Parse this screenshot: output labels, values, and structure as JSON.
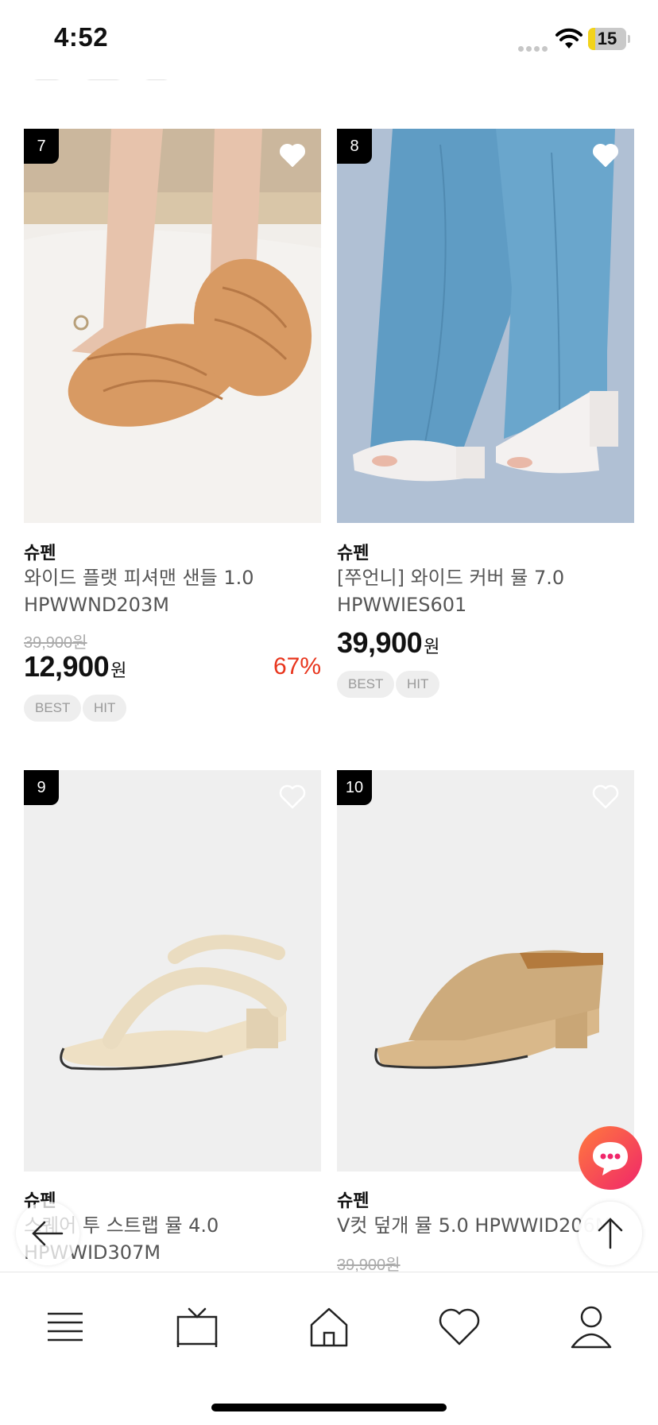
{
  "status_bar": {
    "time": "4:52",
    "battery": "15"
  },
  "products": [
    {
      "rank": "7",
      "brand": "슈펜",
      "name_line1": "와이드 플랫 피셔맨 샌들 1.0",
      "name_line2": "HPWWND203M",
      "original_price": "39,900원",
      "price": "12,900",
      "currency": "원",
      "discount": "67%",
      "tags": [
        "BEST",
        "HIT"
      ]
    },
    {
      "rank": "8",
      "brand": "슈펜",
      "name_line1": "[쭈언니] 와이드 커버 뮬 7.0",
      "name_line2": "HPWWIES601",
      "price": "39,900",
      "currency": "원",
      "tags": [
        "BEST",
        "HIT"
      ]
    },
    {
      "rank": "9",
      "brand": "슈펜",
      "name_line1": "스퀘어 투 스트랩 뮬 4.0",
      "name_line2": "HPWWID307M"
    },
    {
      "rank": "10",
      "brand": "슈펜",
      "name_line1": "V컷 덮개 뮬 5.0 HPWWID206M",
      "original_price": "39,900원"
    }
  ],
  "icons": {
    "heart": "heart-outline-icon",
    "chat": "chat-bubble-icon",
    "scroll_top": "arrow-up-icon",
    "back": "arrow-left-icon",
    "nav": [
      "menu-icon",
      "tv-icon",
      "home-icon",
      "heart-icon",
      "user-icon"
    ]
  },
  "colors": {
    "discount": "#e8351d",
    "chat_gradient_start": "#ff7a3d",
    "chat_gradient_end": "#f0266a"
  }
}
